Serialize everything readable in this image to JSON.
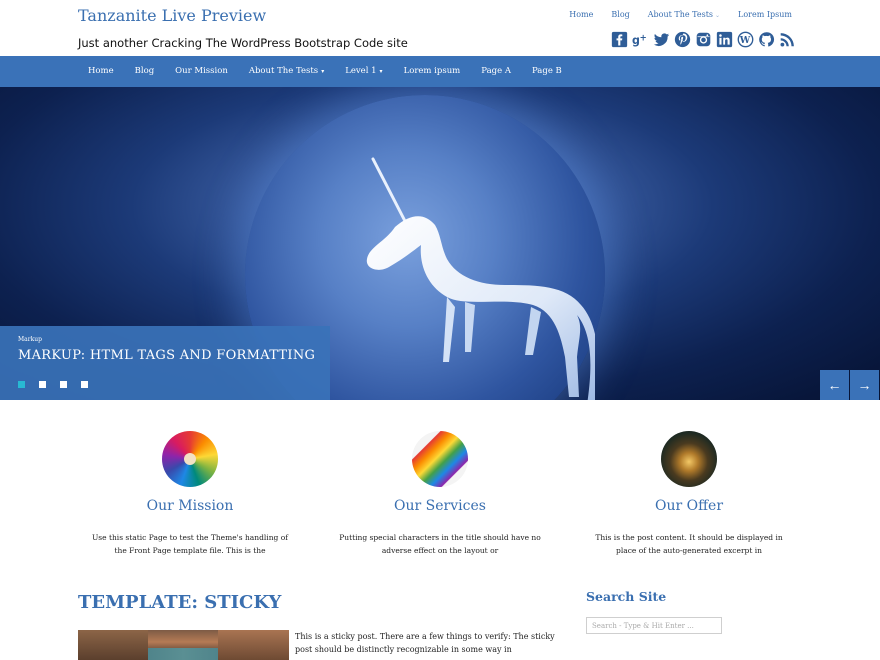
{
  "site": {
    "title": "Tanzanite Live Preview",
    "tagline": "Just another Cracking The WordPress Bootstrap Code site"
  },
  "top_menu": [
    {
      "label": "Home"
    },
    {
      "label": "Blog"
    },
    {
      "label": "About The Tests",
      "has_dropdown": true
    },
    {
      "label": "Lorem Ipsum"
    }
  ],
  "social_icons": [
    "facebook-icon",
    "google-plus-icon",
    "twitter-icon",
    "pinterest-icon",
    "instagram-icon",
    "linkedin-icon",
    "wordpress-icon",
    "github-icon",
    "rss-icon"
  ],
  "nav": [
    {
      "label": "Home"
    },
    {
      "label": "Blog"
    },
    {
      "label": "Our Mission"
    },
    {
      "label": "About The Tests",
      "has_dropdown": true
    },
    {
      "label": "Level 1",
      "has_dropdown": true
    },
    {
      "label": "Lorem ipsum"
    },
    {
      "label": "Page A"
    },
    {
      "label": "Page B"
    }
  ],
  "slider": {
    "category": "Markup",
    "title": "MARKUP: HTML TAGS AND FORMATTING",
    "dot_count": 4,
    "active_dot": 0,
    "prev_icon": "arrow-left-icon",
    "next_icon": "arrow-right-icon"
  },
  "features": [
    {
      "title": "Our Mission",
      "text": "Use this static Page to test the Theme's handling of the Front Page template file. This is the"
    },
    {
      "title": "Our Services",
      "text": "Putting special characters in the title should have no adverse effect on the layout or"
    },
    {
      "title": "Our Offer",
      "text": "This is the post content. It should be displayed in place of the auto-generated excerpt in"
    }
  ],
  "post": {
    "title": "TEMPLATE: STICKY",
    "excerpt": "This is a sticky post. There are a few things to verify: The sticky post should be distinctly recognizable in some way in"
  },
  "sidebar": {
    "search_title": "Search Site",
    "search_placeholder": "Search - Type & Hit Enter ..."
  },
  "colors": {
    "brand": "#3a72b8",
    "title": "#3a6fb0",
    "dot_active": "#28b9d3"
  }
}
